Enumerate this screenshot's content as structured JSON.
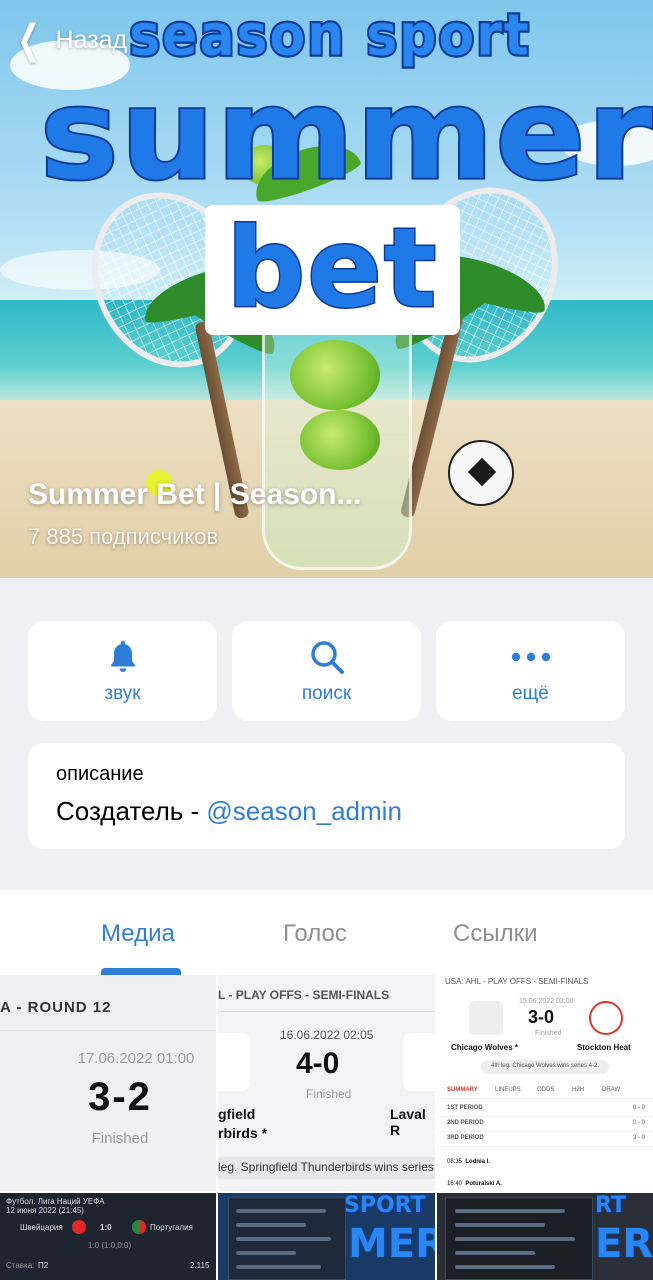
{
  "nav": {
    "back_label": "Назад"
  },
  "channel": {
    "title": "Summer Bet | Season...",
    "subscribers": "7 885 подписчиков",
    "poster": {
      "line1": "season sport",
      "line2": "summer",
      "line3": "bet"
    }
  },
  "actions": [
    {
      "label": "звук",
      "icon": "bell-icon"
    },
    {
      "label": "поиск",
      "icon": "search-icon"
    },
    {
      "label": "ещё",
      "icon": "more-icon"
    }
  ],
  "description": {
    "label": "описание",
    "text": "Создатель - ",
    "link": "@season_admin"
  },
  "tabs": [
    {
      "label": "Медиа",
      "active": true
    },
    {
      "label": "Голос",
      "active": false
    },
    {
      "label": "Ссылки",
      "active": false
    }
  ],
  "media": {
    "m1": {
      "round": "A - ROUND 12",
      "date": "17.06.2022 01:00",
      "score": "3-2",
      "status": "Finished"
    },
    "m2": {
      "round": "L - PLAY OFFS - SEMI-FINALS",
      "date": "16.06.2022 02:05",
      "score": "4-0",
      "status": "Finished",
      "team1_line1": "gfield",
      "team1_line2": "rbirds *",
      "team2": "Laval R",
      "footer": "leg. Springfield Thunderbirds wins series"
    },
    "m3": {
      "top": "USA: AHL - PLAY OFFS - SEMI-FINALS",
      "date": "15.06.2022 03:00",
      "score": "3-0",
      "status": "Finished",
      "home": "Chicago Wolves *",
      "away": "Stockton Heat",
      "series": "4th leg. Chicago Wolves wins series 4-2.",
      "tabs": [
        "SUMMARY",
        "LINEUPS",
        "ODDS",
        "H2H",
        "DRAW"
      ],
      "periods": [
        {
          "name": "1ST PERIOD",
          "score": "0 - 0"
        },
        {
          "name": "2ND PERIOD",
          "score": "0 - 0"
        },
        {
          "name": "3RD PERIOD",
          "score": "3 - 0"
        }
      ],
      "events": [
        {
          "time": "08:35",
          "text": "Lodnia I."
        },
        {
          "time": "16:40",
          "text": "Poturalski A."
        }
      ]
    },
    "m4": {
      "league": "Футбол. Лига Наций УЕФА",
      "date": "12 июня 2022 (21:45)",
      "home": "Швейцария",
      "score": "1:0",
      "away": "Португалия",
      "half": "1:0 (1:0,0:0)",
      "bet_label": "Ставка:",
      "bet": "П2",
      "odds": "2.115"
    }
  }
}
